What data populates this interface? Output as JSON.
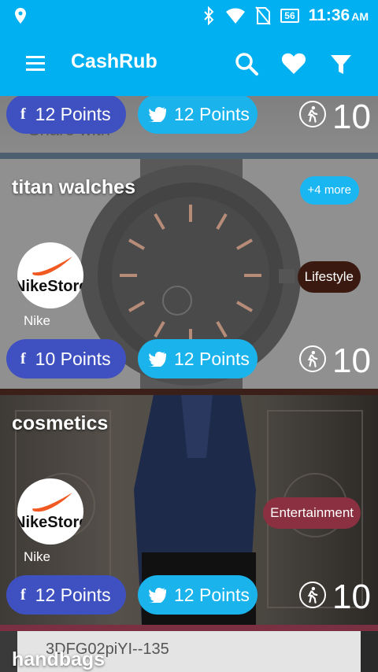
{
  "status": {
    "battery": "56",
    "time": "11:36",
    "ampm": "AM"
  },
  "appbar": {
    "title": "CashRub"
  },
  "cards": [
    {
      "fb_points": "12 Points",
      "tw_points": "12 Points",
      "count": "10",
      "behind_text": "Share with"
    },
    {
      "title": "titan walches",
      "more": "+4 more",
      "logo_text": "NikeStore",
      "brand": "Nike",
      "category": "Lifestyle",
      "category_color": "#3a1a10",
      "fb_points": "10 Points",
      "tw_points": "12 Points",
      "count": "10"
    },
    {
      "title": "cosmetics",
      "logo_text": "NikeStore",
      "brand": "Nike",
      "category": "Entertainment",
      "category_color": "#8b3040",
      "fb_points": "12 Points",
      "tw_points": "12 Points",
      "count": "10"
    },
    {
      "title": "handbags",
      "code_text": "3DFG02piYI--135"
    }
  ],
  "colors": {
    "primary": "#00b0f0",
    "facebook": "#3f51c0",
    "twitter": "#1ab3ec",
    "nike_swoosh": "#f05a22"
  }
}
